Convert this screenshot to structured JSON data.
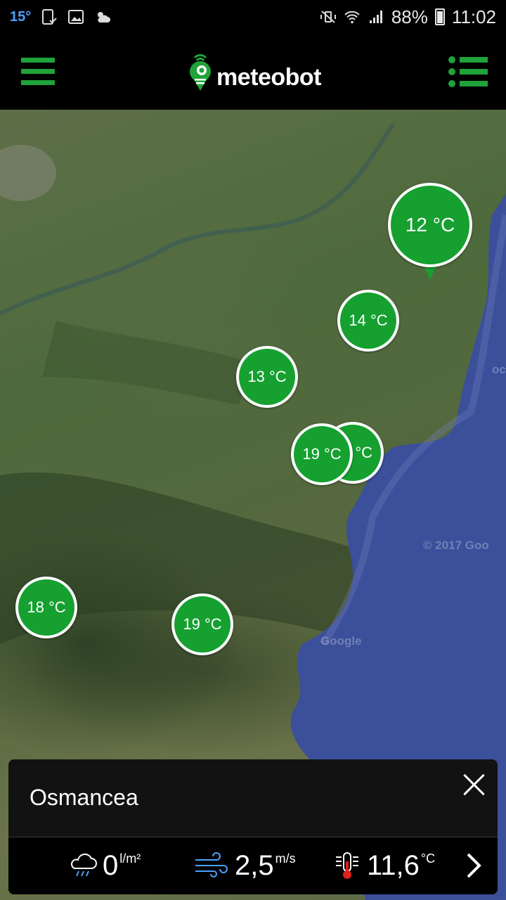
{
  "status_bar": {
    "temp": "15°",
    "battery": "88%",
    "time": "11:02"
  },
  "app": {
    "logo_text": "meteobot",
    "accent_color": "#1fa33a"
  },
  "map": {
    "watermarks": [
      "Google",
      "© 2017 Goo",
      "oc"
    ],
    "markers": [
      {
        "label": "12 °C",
        "selected": true
      },
      {
        "label": "14 °C"
      },
      {
        "label": "13 °C"
      },
      {
        "label": "°C"
      },
      {
        "label": "19 °C"
      },
      {
        "label": "18 °C"
      },
      {
        "label": "19 °C"
      }
    ]
  },
  "panel": {
    "station": "Osmancea",
    "rain_value": "0",
    "rain_unit": "l/m²",
    "wind_value": "2,5",
    "wind_unit": "m/s",
    "temp_value": "11,6",
    "temp_unit": "°C"
  }
}
